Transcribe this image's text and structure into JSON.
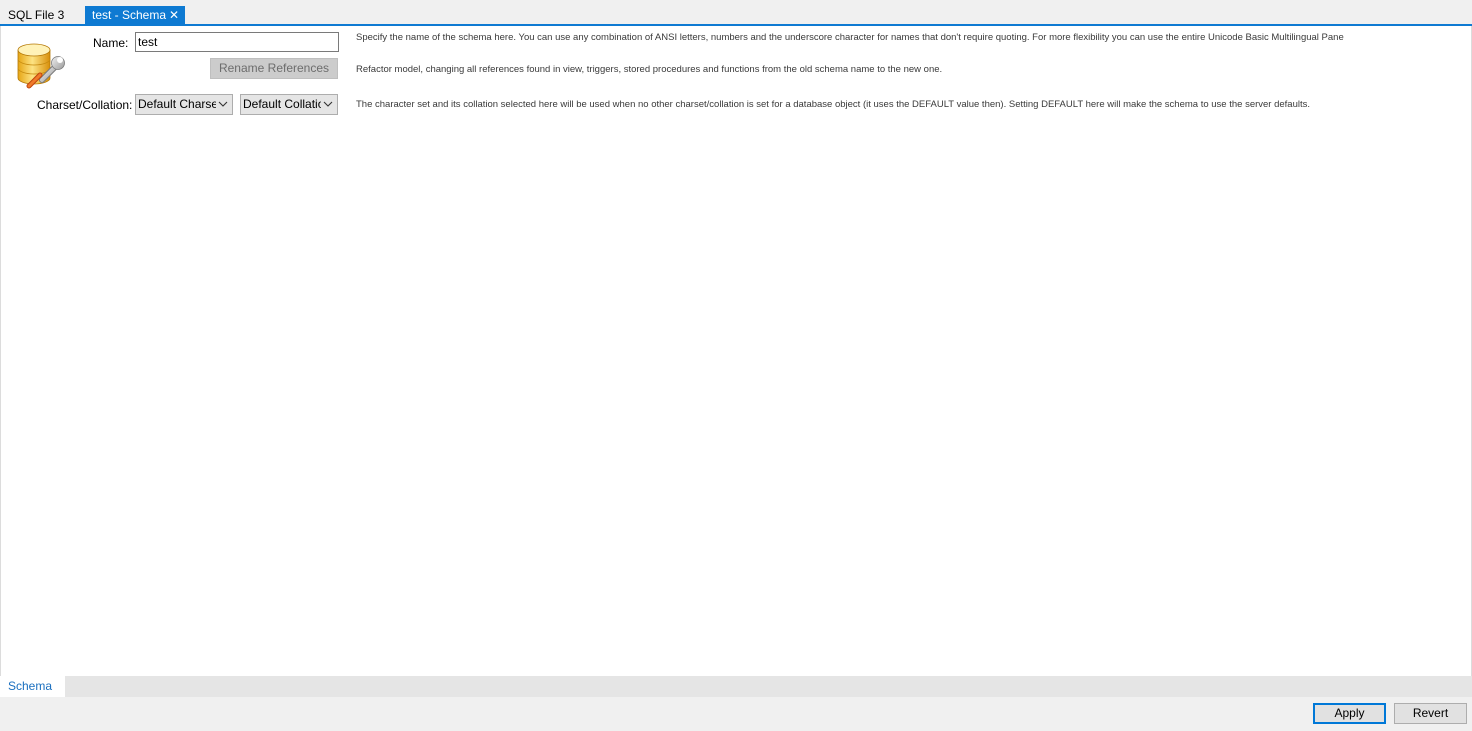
{
  "tabs": {
    "sql_file": "SQL File 3",
    "schema": "test - Schema",
    "close_glyph": "✕"
  },
  "form": {
    "name_label": "Name:",
    "name_value": "test",
    "rename_button": "Rename References",
    "charset_label": "Charset/Collation:",
    "charset_value": "Default Charset",
    "collation_value": "Default Collation"
  },
  "help": {
    "name": "Specify the name of the schema here. You can use any combination of ANSI letters, numbers and the underscore character for names that don't require quoting. For more flexibility you can use the entire Unicode Basic Multilingual Pane",
    "rename": "Refactor model, changing all references found in view, triggers, stored procedures and functions from the old schema name to the new one.",
    "charset": "The character set and its collation selected here will be used when no other charset/collation is set for a database object (it uses the DEFAULT value then). Setting DEFAULT here will make the schema to use the server defaults."
  },
  "bottom_tabs": {
    "schema": "Schema"
  },
  "footer": {
    "apply": "Apply",
    "revert": "Revert"
  },
  "icons": {
    "schema": "database-wrench-icon",
    "dropdown": "chevron-down-icon",
    "close": "close-icon"
  },
  "colors": {
    "accent": "#0e7ad2",
    "bottom_tab_text": "#1a6fbf"
  }
}
